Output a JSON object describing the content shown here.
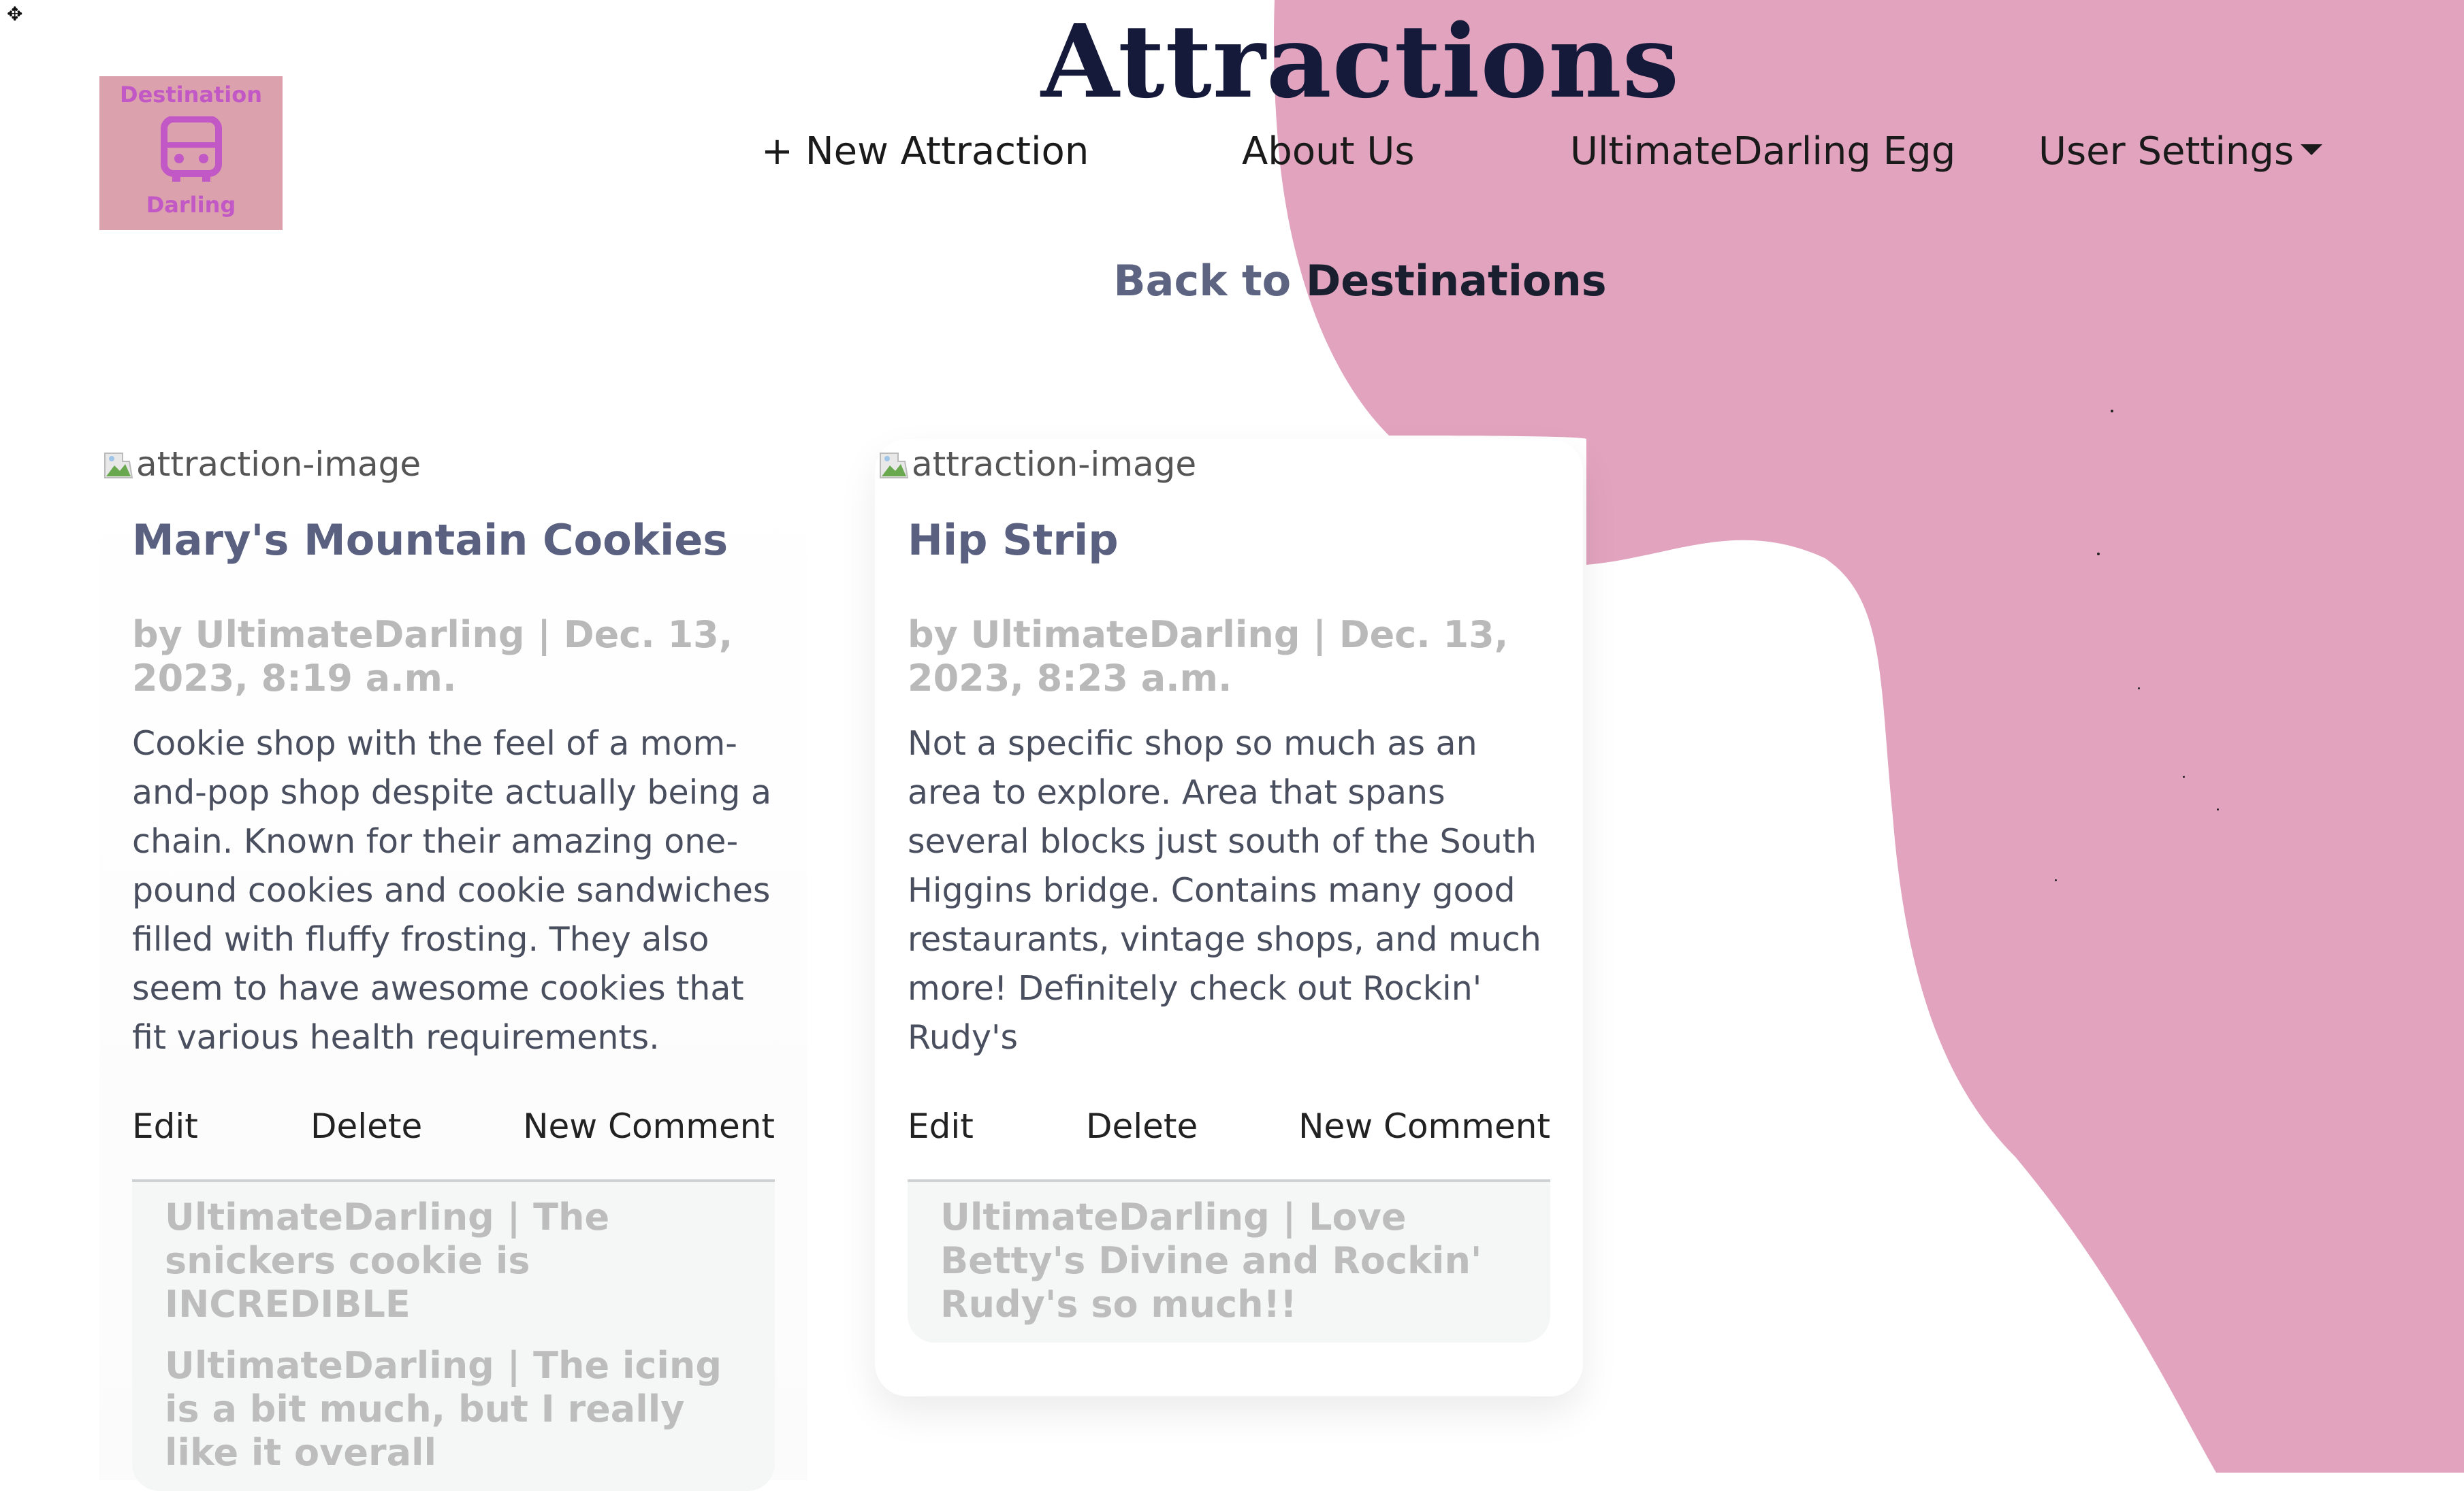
{
  "page": {
    "title": "Attractions"
  },
  "logo": {
    "line1": "Destination",
    "line2": "Darling",
    "icon": "bus-icon"
  },
  "nav": {
    "new_attraction": "+ New Attraction",
    "about_us": "About Us",
    "egg": "UltimateDarling Egg",
    "user_settings": "User Settings"
  },
  "back_link": {
    "prefix": "Back to",
    "destination": "Destinations"
  },
  "colors": {
    "accent_pink": "#e2a3be",
    "title_navy": "#15193a",
    "logo_bg": "#dba1ad",
    "logo_text": "#c158c5"
  },
  "attractions": [
    {
      "image_alt": "attraction-image",
      "title": "Mary's Mountain Cookies",
      "meta": "by UltimateDarling | Dec. 13, 2023, 8:19 a.m.",
      "description": "Cookie shop with the feel of a mom-and-pop shop despite actually being a chain. Known for their amazing one-pound cookies and cookie sandwiches filled with fluffy frosting. They also seem to have awesome cookies that fit various health requirements.",
      "actions": {
        "edit": "Edit",
        "delete": "Delete",
        "new_comment": "New Comment"
      },
      "comments": [
        "UltimateDarling | The snickers cookie is INCREDIBLE",
        "UltimateDarling | The icing is a bit much, but I really like it overall"
      ]
    },
    {
      "image_alt": "attraction-image",
      "title": "Hip Strip",
      "meta": "by UltimateDarling | Dec. 13, 2023, 8:23 a.m.",
      "description": "Not a specific shop so much as an area to explore. Area that spans several blocks just south of the South Higgins bridge. Contains many good restaurants, vintage shops, and much more! Definitely check out Rockin' Rudy's",
      "actions": {
        "edit": "Edit",
        "delete": "Delete",
        "new_comment": "New Comment"
      },
      "comments": [
        "UltimateDarling | Love Betty's Divine and Rockin' Rudy's so much!!"
      ]
    }
  ]
}
